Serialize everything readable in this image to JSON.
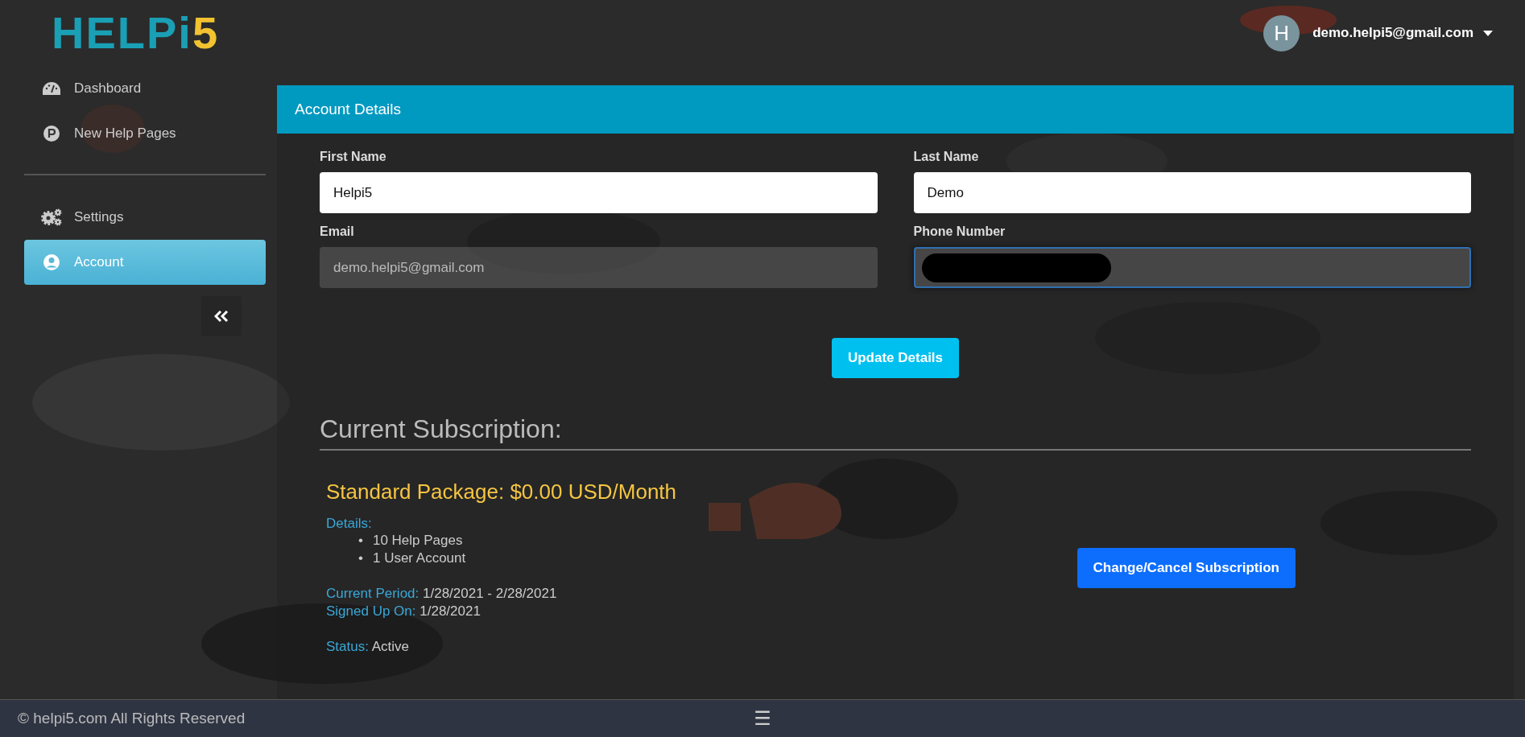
{
  "logo": {
    "text": "HELPi5"
  },
  "user_menu": {
    "avatar_letter": "H",
    "email": "demo.helpi5@gmail.com"
  },
  "sidebar": {
    "groups": [
      {
        "items": [
          {
            "label": "Dashboard",
            "kind": "gauge",
            "selected": false
          },
          {
            "label": "New Help Pages",
            "kind": "parking",
            "selected": false
          }
        ]
      },
      {
        "items": [
          {
            "label": "Settings",
            "kind": "gears",
            "selected": false
          },
          {
            "label": "Account",
            "kind": "user",
            "selected": true
          }
        ]
      }
    ]
  },
  "panel": {
    "title": "Account Details",
    "fields": [
      {
        "label": "First Name",
        "value": "Helpi5",
        "disabled": false,
        "focused": false,
        "redacted": false
      },
      {
        "label": "Last Name",
        "value": "Demo",
        "disabled": false,
        "focused": false,
        "redacted": false
      },
      {
        "label": "Email",
        "value": "demo.helpi5@gmail.com",
        "disabled": true,
        "focused": false,
        "redacted": false
      },
      {
        "label": "Phone Number",
        "disabled": false,
        "focused": true,
        "redacted": true
      }
    ],
    "update_button": "Update Details",
    "subscription": {
      "heading": "Current Subscription:",
      "package": "Standard Package: $0.00 USD/Month",
      "details_label": "Details:",
      "details": [
        {
          "marker": "•",
          "text": "10 Help Pages"
        },
        {
          "marker": "•",
          "text": "1 User Account"
        }
      ],
      "period_label": "Current Period:",
      "period": "1/28/2021 - 2/28/2021",
      "signup_label": "Signed Up On:",
      "signup": "1/28/2021",
      "status_label": "Status:",
      "status": "Active",
      "change_button": "Change/Cancel Subscription"
    }
  },
  "footer": {
    "copyright": "© helpi5.com All Rights Reserved",
    "menu_glyph": "☰"
  }
}
